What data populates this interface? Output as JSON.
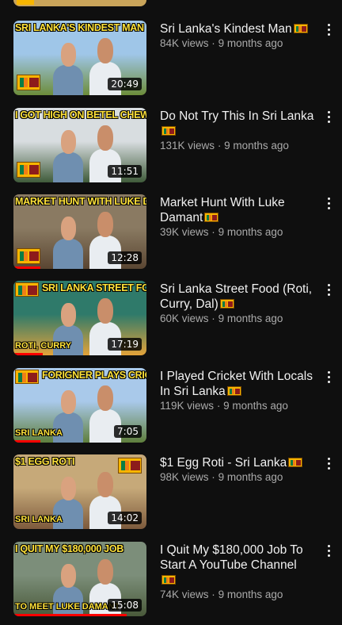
{
  "videos": [
    {
      "thumb_caption": "SRI LANKA'S KINDEST MAN",
      "thumb_caption_bottom": "",
      "title": "Sri Lanka's Kindest Man",
      "views": "84K views",
      "age": "9 months ago",
      "duration": "20:49",
      "watched_progress": 0,
      "colors": {
        "sky": "#9fc6e8",
        "ground": "#6d8d3a",
        "caption": "#ffe23a"
      }
    },
    {
      "thumb_caption": "I GOT HIGH ON BETEL CHEW",
      "thumb_caption_bottom": "",
      "title": "Do Not Try This In Sri Lanka",
      "views": "131K views",
      "age": "9 months ago",
      "duration": "11:51",
      "watched_progress": 0,
      "colors": {
        "sky": "#d8dde0",
        "ground": "#3f5b3a",
        "caption": "#ffe23a"
      }
    },
    {
      "thumb_caption": "MARKET HUNT WITH LUKE DAMANT",
      "thumb_caption_bottom": "",
      "title": "Market Hunt With Luke Damant",
      "views": "39K views",
      "age": "9 months ago",
      "duration": "12:28",
      "watched_progress": 0.2,
      "colors": {
        "sky": "#8a7a62",
        "ground": "#5a4632",
        "caption": "#ffe23a"
      }
    },
    {
      "thumb_caption": "SRI LANKA STREET FOOD",
      "thumb_caption_bottom": "ROTI, CURRY",
      "title": "Sri Lanka Street Food (Roti, Curry, Dal)",
      "views": "60K views",
      "age": "9 months ago",
      "duration": "17:19",
      "watched_progress": 0.22,
      "colors": {
        "sky": "#2f7a6a",
        "ground": "#e3a33a",
        "caption": "#ffe23a"
      }
    },
    {
      "thumb_caption": "FORIGNER PLAYS CRICKET",
      "thumb_caption_bottom": "SRI LANKA",
      "title": "I Played Cricket With Locals In Sri Lanka",
      "views": "119K views",
      "age": "9 months ago",
      "duration": "7:05",
      "watched_progress": 0.2,
      "colors": {
        "sky": "#a9c9ea",
        "ground": "#5f7f3c",
        "caption": "#ffe23a"
      }
    },
    {
      "thumb_caption": "$1 EGG ROTI",
      "thumb_caption_bottom": "SRI LANKA",
      "title": "$1 Egg Roti - Sri Lanka",
      "views": "98K views",
      "age": "9 months ago",
      "duration": "14:02",
      "watched_progress": 0,
      "colors": {
        "sky": "#c6a979",
        "ground": "#7d5a3c",
        "caption": "#ffe23a"
      }
    },
    {
      "thumb_caption": "I QUIT MY $180,000 JOB",
      "thumb_caption_bottom": "TO MEET LUKE DAMANT",
      "title": "I Quit My $180,000 Job To Start A YouTube Channel",
      "views": "74K views",
      "age": "9 months ago",
      "duration": "15:08",
      "watched_progress": 0.85,
      "colors": {
        "sky": "#7c8e7a",
        "ground": "#4a5a3a",
        "caption": "#ffe23a"
      }
    }
  ],
  "separator": "·",
  "icons": {
    "more": "more-vert-icon",
    "flag": "sri-lanka-flag-icon"
  },
  "theme": {
    "background": "#0f0f0f",
    "text": "#f1f1f1",
    "secondary_text": "#aaaaaa",
    "progress": "#ff0000"
  }
}
